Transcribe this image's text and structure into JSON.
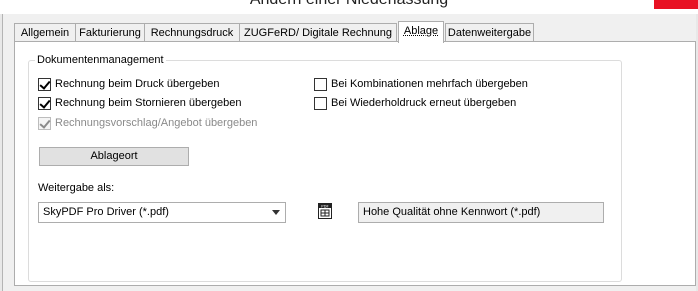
{
  "window": {
    "title": "Ändern einer Niederlassung"
  },
  "tabs": [
    {
      "label": "Allgemein"
    },
    {
      "label": "Fakturierung"
    },
    {
      "label": "Rechnungsdruck"
    },
    {
      "label": "ZUGFeRD/ Digitale Rechnung"
    },
    {
      "label": "Ablage"
    },
    {
      "label": "Datenweitergabe"
    }
  ],
  "active_tab": "Ablage",
  "group": {
    "label": "Dokumentenmanagement",
    "checkboxes_left": [
      {
        "label": "Rechnung beim Druck übergeben",
        "checked": true,
        "enabled": true
      },
      {
        "label": "Rechnung beim Stornieren übergeben",
        "checked": true,
        "enabled": true
      },
      {
        "label": "Rechnungsvorschlag/Angebot übergeben",
        "checked": true,
        "enabled": false
      }
    ],
    "checkboxes_right": [
      {
        "label": "Bei Kombinationen mehrfach übergeben",
        "checked": false,
        "enabled": true
      },
      {
        "label": "Bei Wiederholdruck erneut übergeben",
        "checked": false,
        "enabled": true
      }
    ],
    "ablageort_button": "Ablageort",
    "weitergabe_label": "Weitergabe als:",
    "driver_select_value": "SkyPDF Pro Driver (*.pdf)",
    "pdf_icon": "pdf-settings-icon",
    "profile_field_value": "Hohe Qualität ohne Kennwort (*.pdf)"
  }
}
